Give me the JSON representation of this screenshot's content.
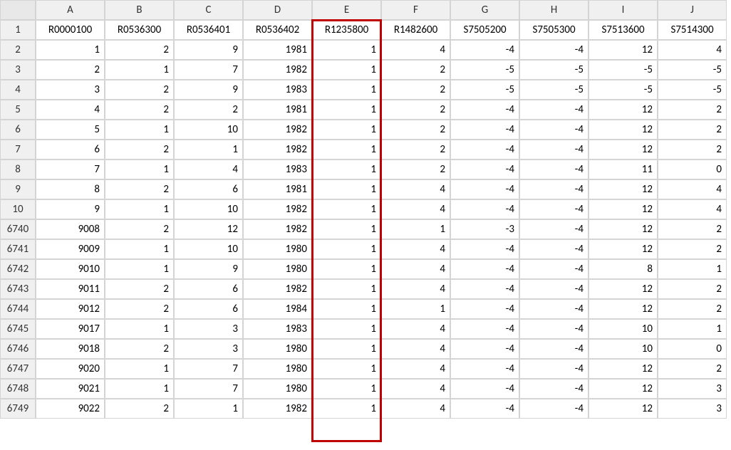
{
  "columns": [
    "A",
    "B",
    "C",
    "D",
    "E",
    "F",
    "G",
    "H",
    "I",
    "J"
  ],
  "rowNumbers": [
    "1",
    "2",
    "3",
    "4",
    "5",
    "6",
    "7",
    "8",
    "9",
    "10",
    "6740",
    "6741",
    "6742",
    "6743",
    "6744",
    "6745",
    "6746",
    "6747",
    "6748",
    "6749"
  ],
  "headerRow": [
    "R0000100",
    "R0536300",
    "R0536401",
    "R0536402",
    "R1235800",
    "R1482600",
    "S7505200",
    "S7505300",
    "S7513600",
    "S7514300"
  ],
  "dataRows": [
    [
      "1",
      "2",
      "9",
      "1981",
      "1",
      "4",
      "-4",
      "-4",
      "12",
      "4"
    ],
    [
      "2",
      "1",
      "7",
      "1982",
      "1",
      "2",
      "-5",
      "-5",
      "-5",
      "-5"
    ],
    [
      "3",
      "2",
      "9",
      "1983",
      "1",
      "2",
      "-5",
      "-5",
      "-5",
      "-5"
    ],
    [
      "4",
      "2",
      "2",
      "1981",
      "1",
      "2",
      "-4",
      "-4",
      "12",
      "2"
    ],
    [
      "5",
      "1",
      "10",
      "1982",
      "1",
      "2",
      "-4",
      "-4",
      "12",
      "2"
    ],
    [
      "6",
      "2",
      "1",
      "1982",
      "1",
      "2",
      "-4",
      "-4",
      "12",
      "2"
    ],
    [
      "7",
      "1",
      "4",
      "1983",
      "1",
      "2",
      "-4",
      "-4",
      "11",
      "0"
    ],
    [
      "8",
      "2",
      "6",
      "1981",
      "1",
      "4",
      "-4",
      "-4",
      "12",
      "4"
    ],
    [
      "9",
      "1",
      "10",
      "1982",
      "1",
      "4",
      "-4",
      "-4",
      "12",
      "4"
    ],
    [
      "9008",
      "2",
      "12",
      "1982",
      "1",
      "1",
      "-3",
      "-4",
      "12",
      "2"
    ],
    [
      "9009",
      "1",
      "10",
      "1980",
      "1",
      "4",
      "-4",
      "-4",
      "12",
      "2"
    ],
    [
      "9010",
      "1",
      "9",
      "1980",
      "1",
      "4",
      "-4",
      "-4",
      "8",
      "1"
    ],
    [
      "9011",
      "2",
      "6",
      "1982",
      "1",
      "4",
      "-4",
      "-4",
      "12",
      "2"
    ],
    [
      "9012",
      "2",
      "6",
      "1984",
      "1",
      "1",
      "-4",
      "-4",
      "12",
      "2"
    ],
    [
      "9017",
      "1",
      "3",
      "1983",
      "1",
      "4",
      "-4",
      "-4",
      "10",
      "1"
    ],
    [
      "9018",
      "2",
      "3",
      "1980",
      "1",
      "4",
      "-4",
      "-4",
      "10",
      "0"
    ],
    [
      "9020",
      "1",
      "7",
      "1980",
      "1",
      "4",
      "-4",
      "-4",
      "12",
      "2"
    ],
    [
      "9021",
      "1",
      "7",
      "1980",
      "1",
      "4",
      "-4",
      "-4",
      "12",
      "3"
    ],
    [
      "9022",
      "2",
      "1",
      "1982",
      "1",
      "4",
      "-4",
      "-4",
      "12",
      "3"
    ]
  ],
  "highlightColumn": "E",
  "chart_data": {
    "type": "table",
    "title": "",
    "columns": [
      "R0000100",
      "R0536300",
      "R0536401",
      "R0536402",
      "R1235800",
      "R1482600",
      "S7505200",
      "S7505300",
      "S7513600",
      "S7514300"
    ],
    "rows": [
      [
        1,
        2,
        9,
        1981,
        1,
        4,
        -4,
        -4,
        12,
        4
      ],
      [
        2,
        1,
        7,
        1982,
        1,
        2,
        -5,
        -5,
        -5,
        -5
      ],
      [
        3,
        2,
        9,
        1983,
        1,
        2,
        -5,
        -5,
        -5,
        -5
      ],
      [
        4,
        2,
        2,
        1981,
        1,
        2,
        -4,
        -4,
        12,
        2
      ],
      [
        5,
        1,
        10,
        1982,
        1,
        2,
        -4,
        -4,
        12,
        2
      ],
      [
        6,
        2,
        1,
        1982,
        1,
        2,
        -4,
        -4,
        12,
        2
      ],
      [
        7,
        1,
        4,
        1983,
        1,
        2,
        -4,
        -4,
        11,
        0
      ],
      [
        8,
        2,
        6,
        1981,
        1,
        4,
        -4,
        -4,
        12,
        4
      ],
      [
        9,
        1,
        10,
        1982,
        1,
        4,
        -4,
        -4,
        12,
        4
      ],
      [
        9008,
        2,
        12,
        1982,
        1,
        1,
        -3,
        -4,
        12,
        2
      ],
      [
        9009,
        1,
        10,
        1980,
        1,
        4,
        -4,
        -4,
        12,
        2
      ],
      [
        9010,
        1,
        9,
        1980,
        1,
        4,
        -4,
        -4,
        8,
        1
      ],
      [
        9011,
        2,
        6,
        1982,
        1,
        4,
        -4,
        -4,
        12,
        2
      ],
      [
        9012,
        2,
        6,
        1984,
        1,
        1,
        -4,
        -4,
        12,
        2
      ],
      [
        9017,
        1,
        3,
        1983,
        1,
        4,
        -4,
        -4,
        10,
        1
      ],
      [
        9018,
        2,
        3,
        1980,
        1,
        4,
        -4,
        -4,
        10,
        0
      ],
      [
        9020,
        1,
        7,
        1980,
        1,
        4,
        -4,
        -4,
        12,
        2
      ],
      [
        9021,
        1,
        7,
        1980,
        1,
        4,
        -4,
        -4,
        12,
        3
      ],
      [
        9022,
        2,
        1,
        1982,
        1,
        4,
        -4,
        -4,
        12,
        3
      ]
    ]
  }
}
